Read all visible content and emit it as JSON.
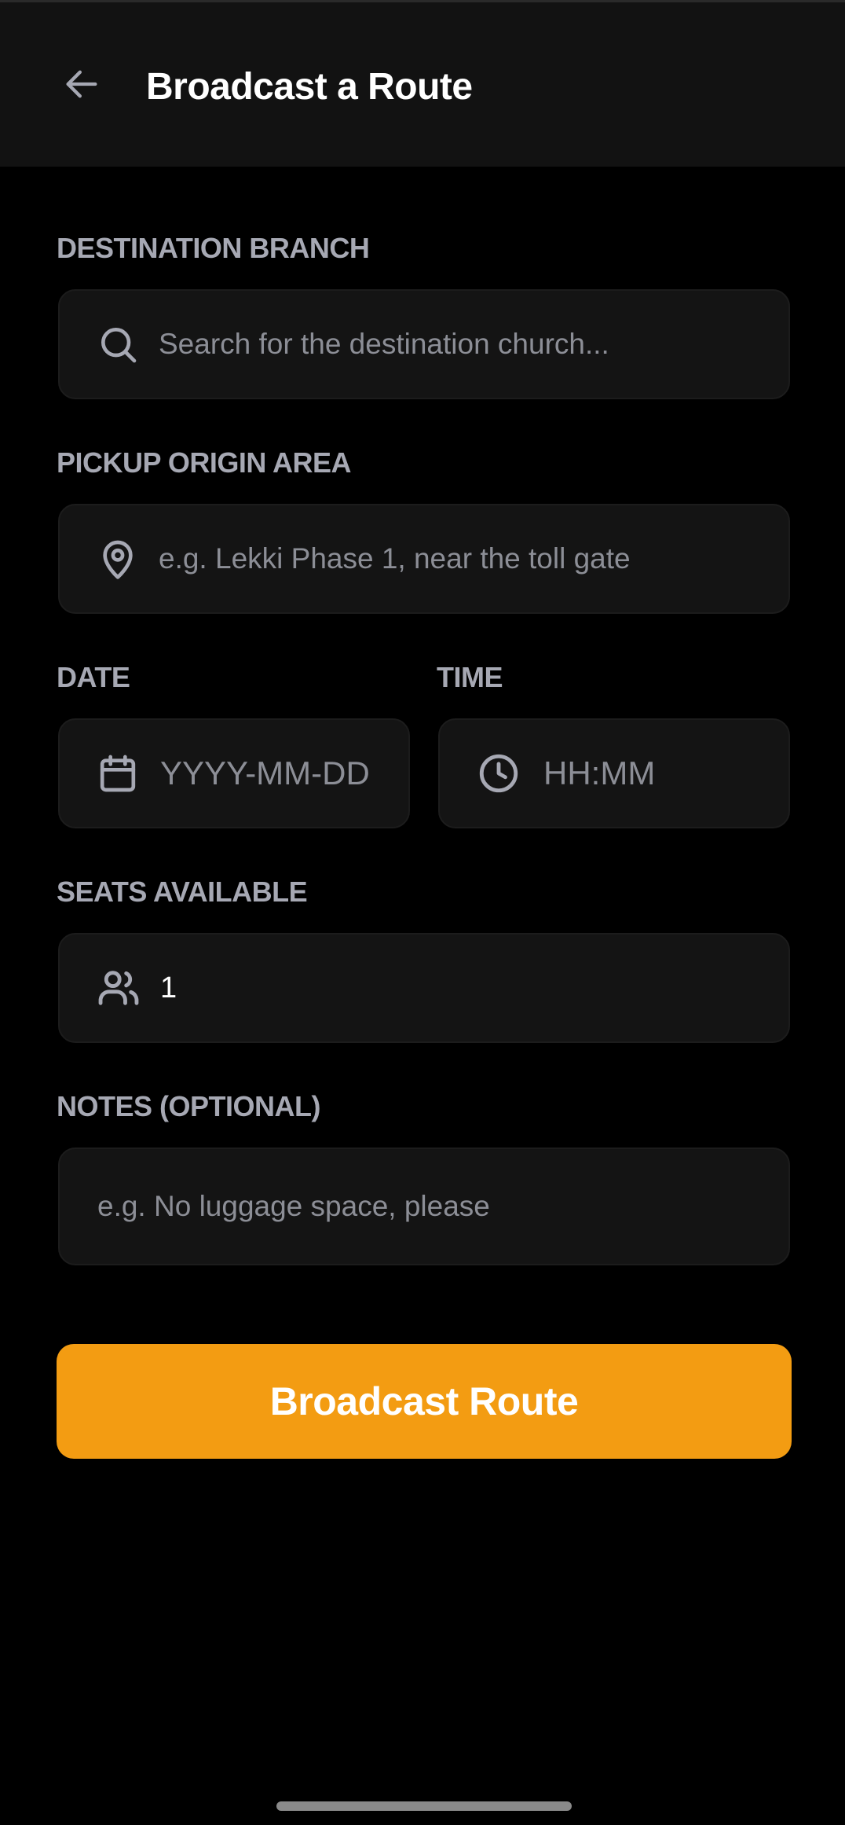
{
  "header": {
    "title": "Broadcast a Route",
    "back_icon": "arrow-left-icon"
  },
  "form": {
    "destination": {
      "label": "DESTINATION BRANCH",
      "placeholder": "Search for the destination church...",
      "icon": "search-icon"
    },
    "pickup": {
      "label": "PICKUP ORIGIN AREA",
      "placeholder": "e.g. Lekki Phase 1, near the toll gate",
      "icon": "map-pin-icon"
    },
    "date": {
      "label": "DATE",
      "placeholder": "YYYY-MM-DD",
      "icon": "calendar-icon"
    },
    "time": {
      "label": "TIME",
      "placeholder": "HH:MM",
      "icon": "clock-icon"
    },
    "seats": {
      "label": "SEATS AVAILABLE",
      "value": "1",
      "icon": "users-icon"
    },
    "notes": {
      "label": "NOTES (OPTIONAL)",
      "placeholder": "e.g. No luggage space, please"
    },
    "submit_label": "Broadcast Route"
  },
  "colors": {
    "background": "#000000",
    "surface": "#141414",
    "appbar": "#121212",
    "accent": "#f39c12",
    "label": "#a6a8b3",
    "placeholder": "#8c8e96"
  }
}
